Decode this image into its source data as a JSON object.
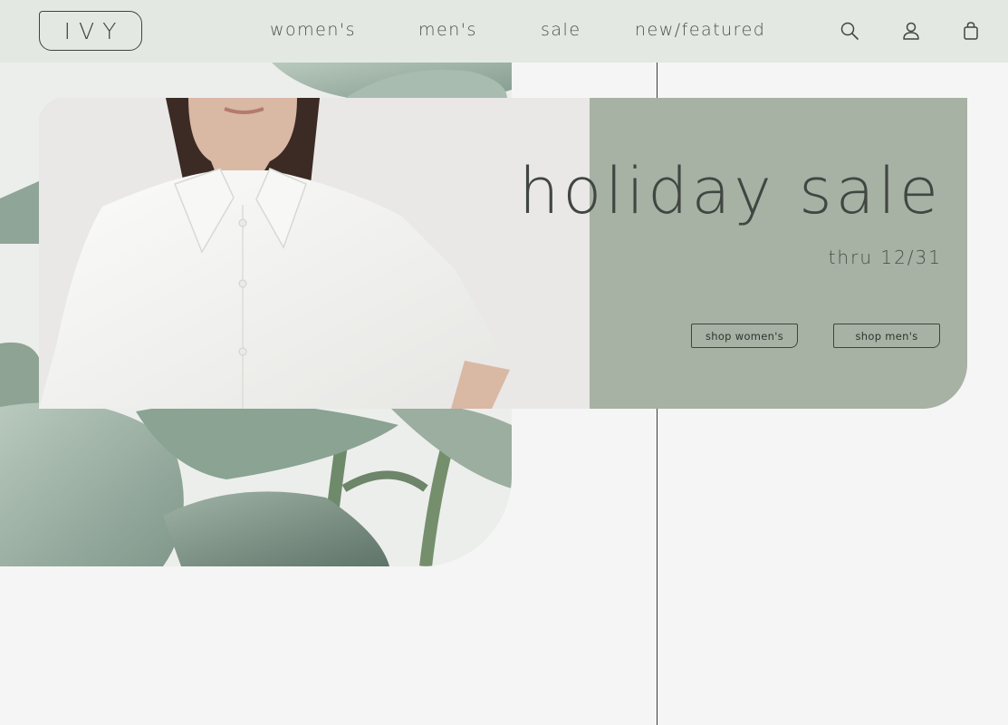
{
  "brand": {
    "logo_text": "IVY"
  },
  "nav": {
    "items": [
      {
        "label": "women's"
      },
      {
        "label": "men's"
      },
      {
        "label": "sale"
      },
      {
        "label": "new/featured"
      }
    ],
    "icons": [
      "search-icon",
      "user-icon",
      "shopping-bag-icon"
    ]
  },
  "hero": {
    "headline": "holiday sale",
    "subline": "thru 12/31",
    "buttons": {
      "shop_womens": "shop women's",
      "shop_mens": "shop men's"
    }
  },
  "colors": {
    "header_bg": "#e3e9e2",
    "sage_panel": "#a7b1a4",
    "text": "#3f4540",
    "page_bg": "#f5f5f5"
  }
}
